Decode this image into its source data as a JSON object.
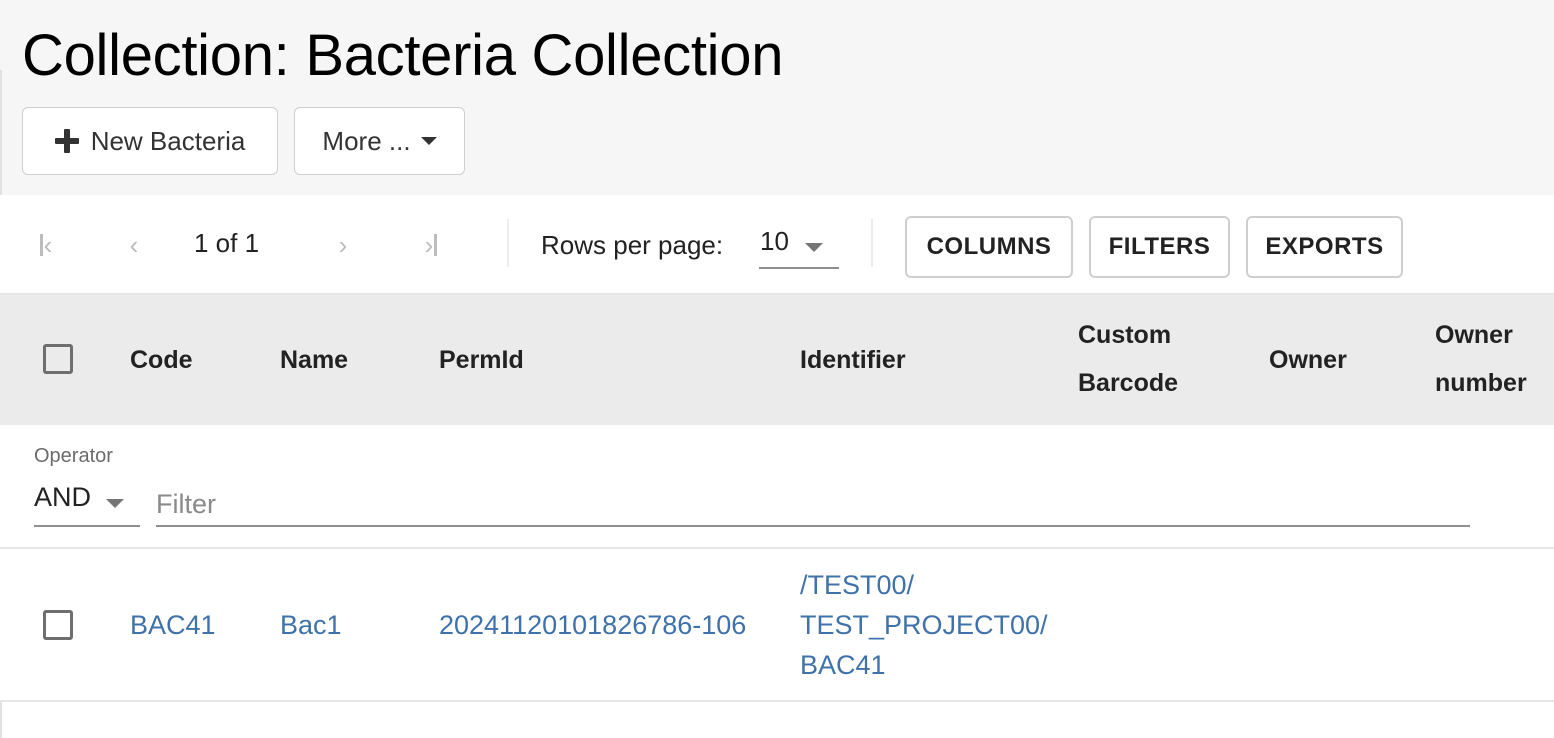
{
  "page": {
    "title": "Collection: Bacteria Collection"
  },
  "actions": {
    "new_button": {
      "label": "New Bacteria",
      "icon": "plus-icon"
    },
    "more_button": {
      "label": "More ...",
      "icon": "caret-down-icon"
    }
  },
  "pagination": {
    "first_icon": "first-page-icon",
    "prev_icon": "chevron-left-icon",
    "status": "1 of 1",
    "next_icon": "chevron-right-icon",
    "last_icon": "last-page-icon",
    "rows_per_page_label": "Rows per page:",
    "rows_per_page_value": "10"
  },
  "toolbar": {
    "columns_label": "COLUMNS",
    "filters_label": "FILTERS",
    "exports_label": "EXPORTS"
  },
  "table": {
    "columns": [
      {
        "key": "code",
        "label": "Code"
      },
      {
        "key": "name",
        "label": "Name"
      },
      {
        "key": "permid",
        "label": "PermId"
      },
      {
        "key": "identifier",
        "label": "Identifier"
      },
      {
        "key": "custom_barcode",
        "label": "Custom Barcode",
        "lines": [
          "Custom",
          "Barcode"
        ]
      },
      {
        "key": "owner",
        "label": "Owner"
      },
      {
        "key": "owner_number",
        "label": "Owner number",
        "lines": [
          "Owner",
          "number"
        ]
      }
    ],
    "filter": {
      "operator_label": "Operator",
      "operator_value": "AND",
      "placeholder": "Filter",
      "value": ""
    },
    "rows": [
      {
        "selected": false,
        "code": "BAC41",
        "name": "Bac1",
        "permid": "20241120101826786-106",
        "identifier": "/TEST00/TEST_PROJECT00/BAC41",
        "identifier_lines": [
          "/TEST00/",
          "TEST_PROJECT00/",
          "BAC41"
        ],
        "custom_barcode": "",
        "owner": "",
        "owner_number": ""
      }
    ]
  },
  "colors": {
    "link": "#3f72ab",
    "header_bg": "#f6f6f6",
    "table_header_bg": "#ebebeb"
  }
}
